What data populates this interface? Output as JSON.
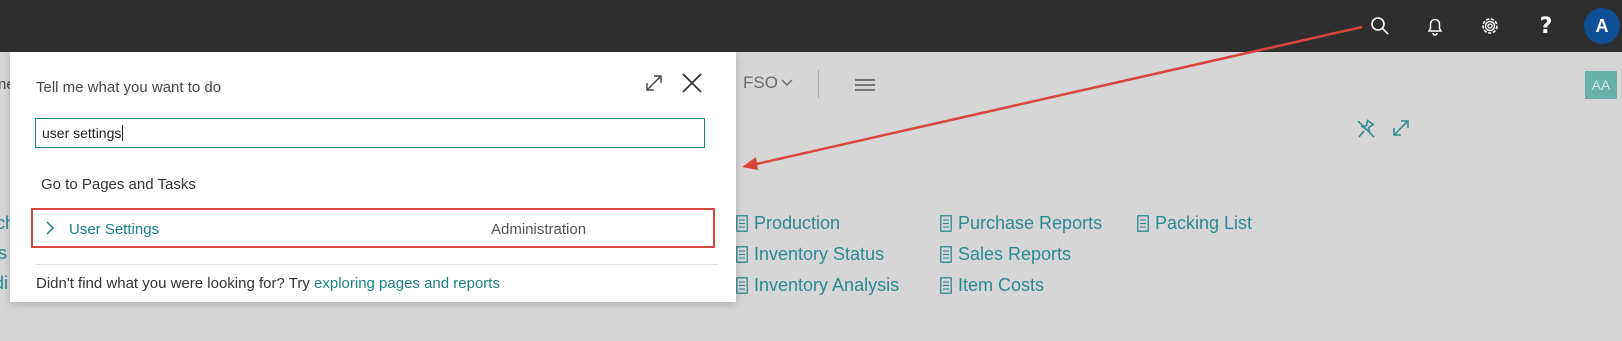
{
  "topbar": {
    "icons": [
      "search-icon",
      "bell-icon",
      "gear-icon",
      "help-icon"
    ],
    "help_glyph": "?",
    "avatar_initial": "A"
  },
  "background": {
    "fso_label": "FSO",
    "badge": "AA",
    "edge_fragments": [
      "ne",
      "ch",
      "s",
      "di"
    ],
    "reports": {
      "col1": [
        "Production",
        "Inventory Status",
        "Inventory Analysis"
      ],
      "col2": [
        "Purchase Reports",
        "Sales Reports",
        "Item Costs"
      ],
      "col3": [
        "Packing List"
      ]
    }
  },
  "dialog": {
    "title": "Tell me what you want to do",
    "search_value": "user settings",
    "section_heading": "Go to Pages and Tasks",
    "result": {
      "label": "User Settings",
      "category": "Administration"
    },
    "footer_text": "Didn't find what you were looking for? Try",
    "footer_link": "exploring pages and reports"
  },
  "colors": {
    "topbar": "#2e2e2e",
    "accent": "#1c7f84",
    "annotation": "#d9453d",
    "avatar": "#0f4f96"
  }
}
